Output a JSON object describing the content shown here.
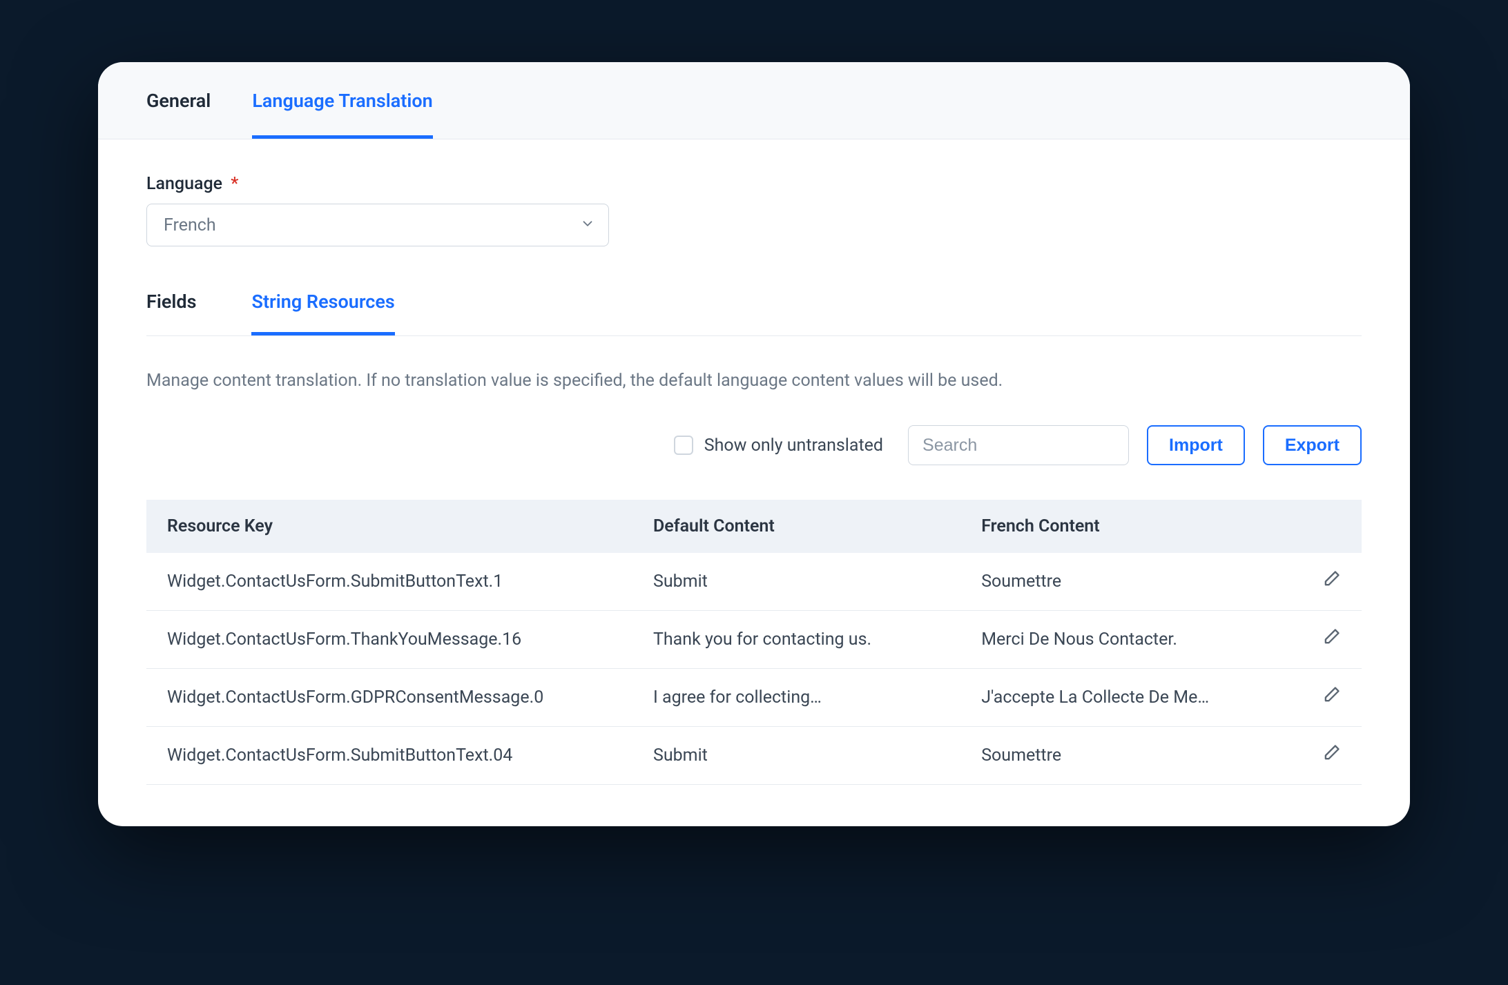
{
  "top_tabs": {
    "general": "General",
    "language_translation": "Language Translation",
    "active": "language_translation"
  },
  "language_field": {
    "label": "Language",
    "required_marker": "*",
    "value": "French"
  },
  "sub_tabs": {
    "fields": "Fields",
    "string_resources": "String Resources",
    "active": "string_resources"
  },
  "description": "Manage content translation. If no translation value is specified, the default language content values will be used.",
  "toolbar": {
    "show_only_untranslated_label": "Show only untranslated",
    "search_placeholder": "Search",
    "import_label": "Import",
    "export_label": "Export"
  },
  "table": {
    "headers": {
      "resource_key": "Resource Key",
      "default_content": "Default Content",
      "translated_content": "French Content"
    },
    "rows": [
      {
        "key": "Widget.ContactUsForm.SubmitButtonText.1",
        "default": "Submit",
        "translated": "Soumettre"
      },
      {
        "key": "Widget.ContactUsForm.ThankYouMessage.16",
        "default": "Thank you for contacting us.",
        "translated": "Merci De Nous Contacter."
      },
      {
        "key": "Widget.ContactUsForm.GDPRConsentMessage.0",
        "default": "I agree for collecting…",
        "translated": "J'accepte La Collecte De Me…"
      },
      {
        "key": "Widget.ContactUsForm.SubmitButtonText.04",
        "default": "Submit",
        "translated": "Soumettre"
      }
    ]
  },
  "icons": {
    "edit": "pencil-icon",
    "chevron_down": "chevron-down-icon"
  },
  "colors": {
    "accent": "#1a6dff",
    "text_primary": "#1f2a37",
    "text_muted": "#6b7785",
    "border": "#cfd6de",
    "table_header_bg": "#eef2f7"
  }
}
